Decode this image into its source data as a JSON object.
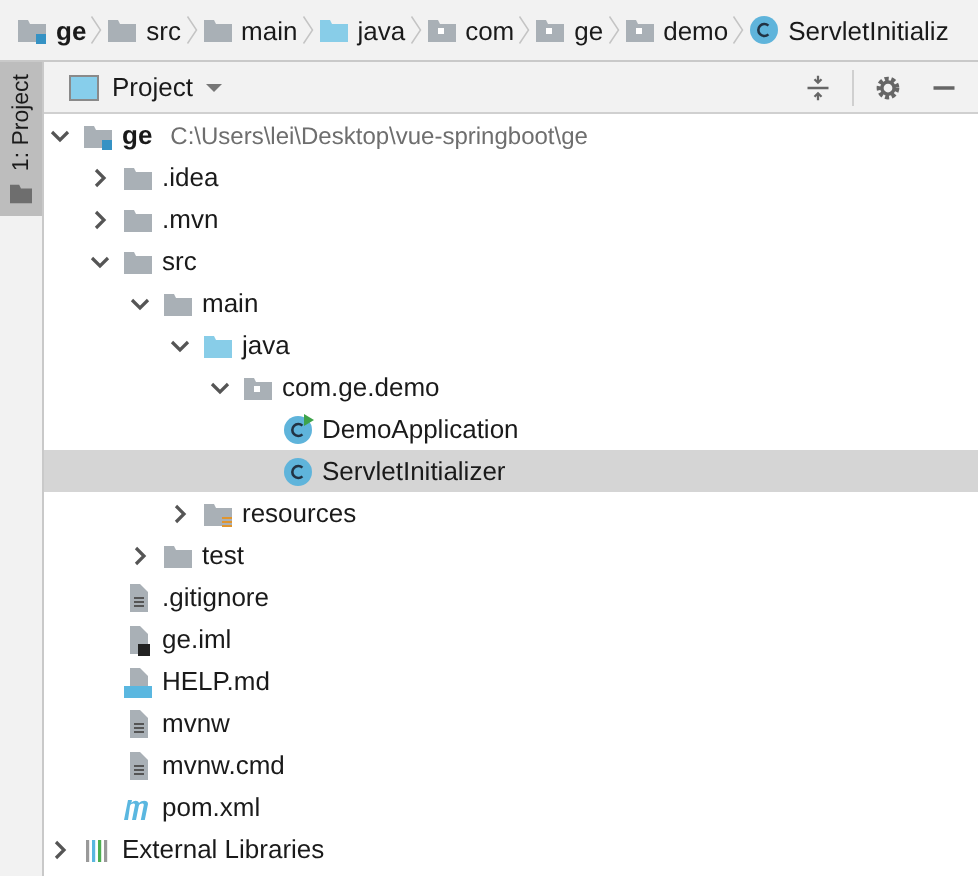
{
  "breadcrumbs": [
    {
      "kind": "module",
      "label": "ge"
    },
    {
      "kind": "folder",
      "label": "src"
    },
    {
      "kind": "folder",
      "label": "main"
    },
    {
      "kind": "source-folder",
      "label": "java"
    },
    {
      "kind": "package",
      "label": "com"
    },
    {
      "kind": "package",
      "label": "ge"
    },
    {
      "kind": "package",
      "label": "demo"
    },
    {
      "kind": "class",
      "label": "ServletInitializ"
    }
  ],
  "side_tab": {
    "label": "1: Project",
    "selected": true
  },
  "panel": {
    "title": "Project"
  },
  "tree": [
    {
      "kind": "module",
      "label": "ge",
      "path": "C:\\Users\\lei\\Desktop\\vue-springboot\\ge",
      "expanded": true,
      "selected": false,
      "children": [
        {
          "kind": "folder",
          "label": ".idea",
          "expanded": false,
          "selected": false
        },
        {
          "kind": "folder",
          "label": ".mvn",
          "expanded": false,
          "selected": false
        },
        {
          "kind": "folder",
          "label": "src",
          "expanded": true,
          "selected": false,
          "children": [
            {
              "kind": "folder",
              "label": "main",
              "expanded": true,
              "selected": false,
              "children": [
                {
                  "kind": "source-folder",
                  "label": "java",
                  "expanded": true,
                  "selected": false,
                  "children": [
                    {
                      "kind": "package",
                      "label": "com.ge.demo",
                      "expanded": true,
                      "selected": false,
                      "children": [
                        {
                          "kind": "runnable-class",
                          "label": "DemoApplication",
                          "selected": false
                        },
                        {
                          "kind": "class",
                          "label": "ServletInitializer",
                          "selected": true
                        }
                      ]
                    }
                  ]
                },
                {
                  "kind": "resources",
                  "label": "resources",
                  "expanded": false,
                  "selected": false
                }
              ]
            },
            {
              "kind": "folder",
              "label": "test",
              "expanded": false,
              "selected": false
            }
          ]
        },
        {
          "kind": "file",
          "label": ".gitignore",
          "selected": false
        },
        {
          "kind": "iml",
          "label": "ge.iml",
          "selected": false
        },
        {
          "kind": "markdown",
          "label": "HELP.md",
          "selected": false
        },
        {
          "kind": "file",
          "label": "mvnw",
          "selected": false
        },
        {
          "kind": "file",
          "label": "mvnw.cmd",
          "selected": false
        },
        {
          "kind": "maven",
          "label": "pom.xml",
          "selected": false
        }
      ]
    },
    {
      "kind": "libraries",
      "label": "External Libraries",
      "expanded": false,
      "selected": false
    }
  ]
}
